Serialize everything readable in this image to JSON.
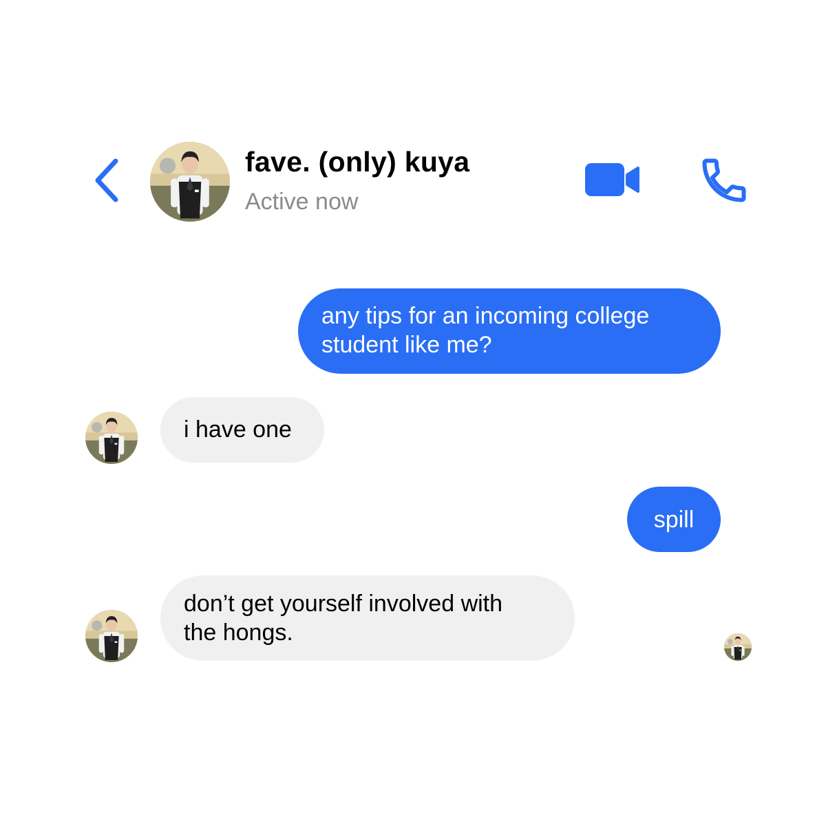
{
  "header": {
    "contact_name": "fave. (only) kuya",
    "status": "Active now",
    "back_icon": "chevron-left-icon",
    "video_icon": "video-camera-icon",
    "call_icon": "phone-icon"
  },
  "messages": [
    {
      "direction": "outgoing",
      "lines": [
        "any tips for an incoming college",
        "student like me?"
      ]
    },
    {
      "direction": "incoming",
      "lines": [
        "i have one"
      ]
    },
    {
      "direction": "outgoing",
      "lines": [
        "spill"
      ]
    },
    {
      "direction": "incoming",
      "lines": [
        "don’t get yourself involved with",
        "the hongs."
      ]
    }
  ],
  "colors": {
    "accent": "#2a6ef5",
    "incoming_bubble": "#f0f0f0",
    "status_text": "#8a8a8e",
    "background": "#ffffff"
  }
}
